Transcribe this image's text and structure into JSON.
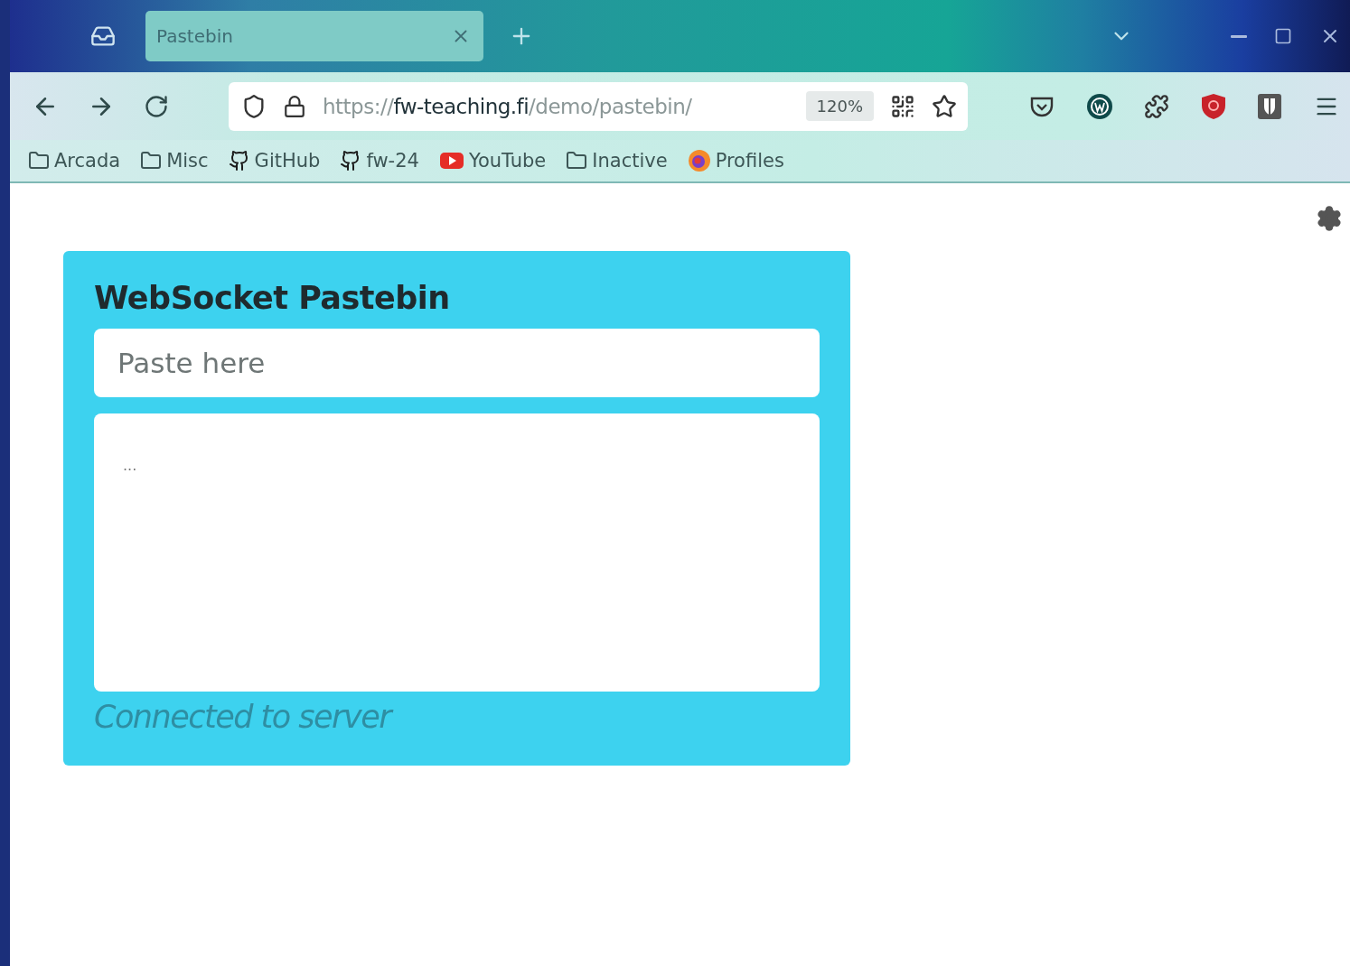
{
  "browser": {
    "tabs": [
      {
        "title": "Pastebin",
        "selected": true
      }
    ],
    "address": {
      "scheme": "https://",
      "host": "fw-teaching.fi",
      "path": "/demo/pastebin/"
    },
    "zoom": "120%",
    "bookmarks": [
      {
        "label": "Arcada",
        "kind": "folder"
      },
      {
        "label": "Misc",
        "kind": "folder"
      },
      {
        "label": "GitHub",
        "kind": "github"
      },
      {
        "label": "fw-24",
        "kind": "github"
      },
      {
        "label": "YouTube",
        "kind": "youtube"
      },
      {
        "label": "Inactive",
        "kind": "folder"
      },
      {
        "label": "Profiles",
        "kind": "profile"
      }
    ]
  },
  "page": {
    "title": "WebSocket Pastebin",
    "input": {
      "placeholder": "Paste here"
    },
    "output": {
      "placeholder": "..."
    },
    "status": "Connected to server"
  }
}
